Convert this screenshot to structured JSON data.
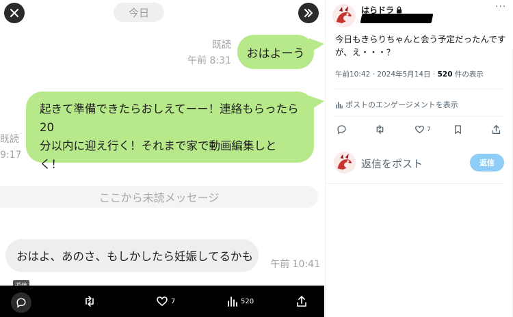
{
  "chat": {
    "date_label": "今日",
    "msg1": {
      "text": "おはよーう",
      "read": "既読",
      "time": "午前 8:31"
    },
    "msg2": {
      "lines": [
        "起きて準備できたらおしえてーー！連絡もらったら20",
        "分以内に迎え行く！それまで家で動画編集しと",
        "く！"
      ],
      "read_cut": "既読",
      "time_cut": "9:17"
    },
    "unread_divider": "ここから未読メッセージ",
    "msg3": {
      "text": "おはよ、あのさ、もしかしたら妊娠してるかも",
      "time": "午前 10:41"
    }
  },
  "media_bar": {
    "tooltip": "返信",
    "like_count": "7",
    "view_count": "520"
  },
  "tweet": {
    "display_name": "はらドラ",
    "text": "今日もきらりちゃんと会う予定だったんですが、え・・・？",
    "time": "午前10:42",
    "date": "2024年5月14日",
    "views": "520",
    "views_suffix": "件の表示",
    "engagement_label": "ポストのエンゲージメントを表示",
    "like_count": "7",
    "reply_placeholder": "返信をポスト",
    "reply_button": "返信"
  },
  "icons": {
    "close": "close-icon",
    "next": "double-chevron-right-icon",
    "reply": "speech-bubble-icon",
    "retweet": "retweet-icon",
    "like": "heart-icon",
    "views": "bar-chart-icon",
    "share": "share-icon",
    "bookmark": "bookmark-icon",
    "lock": "lock-icon"
  },
  "colors": {
    "sent_bubble": "#b7e88a",
    "received_bubble": "#eeeeee",
    "reply_button": "#8ecdf8",
    "muted_text": "#536471"
  }
}
